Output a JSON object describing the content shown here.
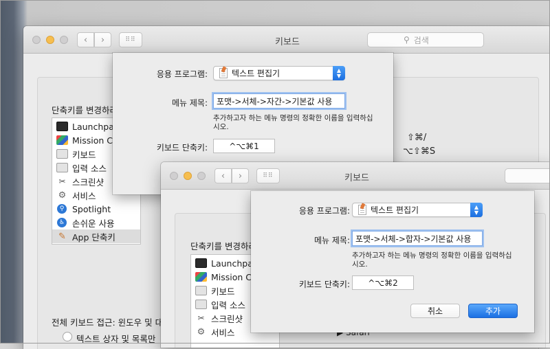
{
  "window_title": "키보드",
  "search_placeholder": "검색",
  "section_label_1": "단축키를 변경하려",
  "section_label_2": "단축키를 변경하려",
  "full_keyboard_label": "전체 키보드 접근: 윈도우 및 대",
  "radio_label": "텍스트 상자 및 목록만",
  "sidebar_items_1": [
    {
      "label": "Launchpa",
      "icon": "launchpad-icon"
    },
    {
      "label": "Mission Co",
      "icon": "mission-control-icon"
    },
    {
      "label": "키보드",
      "icon": "keyboard-icon"
    },
    {
      "label": "입력 소스",
      "icon": "input-source-icon"
    },
    {
      "label": "스크린샷",
      "icon": "screenshot-icon"
    },
    {
      "label": "서비스",
      "icon": "gear-icon"
    },
    {
      "label": "Spotlight",
      "icon": "spotlight-icon"
    },
    {
      "label": "손쉬운 사용",
      "icon": "accessibility-icon"
    },
    {
      "label": "App 단축키",
      "icon": "app-shortcuts-icon"
    }
  ],
  "sidebar_items_2": [
    {
      "label": "Launchpa",
      "icon": "launchpad-icon"
    },
    {
      "label": "Mission Co",
      "icon": "mission-control-icon"
    },
    {
      "label": "키보드",
      "icon": "keyboard-icon"
    },
    {
      "label": "입력 소스",
      "icon": "input-source-icon"
    },
    {
      "label": "스크린샷",
      "icon": "screenshot-icon"
    },
    {
      "label": "서비스",
      "icon": "gear-icon"
    }
  ],
  "shortcut_right_1": "⇧⌘/",
  "shortcut_right_2": "⌥⇧⌘S",
  "tree_item": "Safari",
  "sheet1": {
    "app_label": "응용 프로그램:",
    "app_value": "텍스트 편집기",
    "menu_label": "메뉴 제목:",
    "menu_value": "포맷->서체->자간->기본값 사용",
    "hint": "추가하고자 하는 메뉴 명령의 정확한 이름을 입력하십시오.",
    "hint_line1": "추가하고자 하는 메뉴 명령의 정확한 이름을 입력하십",
    "hint_line2": "시오.",
    "key_label": "키보드 단축키:",
    "key_value": "^⌥⌘1"
  },
  "sheet2": {
    "app_label": "응용 프로그램:",
    "app_value": "텍스트 편집기",
    "menu_label": "메뉴 제목:",
    "menu_value": "포맷->서체->합자->기본값 사용",
    "hint_line1": "추가하고자 하는 메뉴 명령의 정확한 이름을 입력하십",
    "hint_line2": "시오.",
    "key_label": "키보드 단축키:",
    "key_value": "^⌥⌘2",
    "cancel_label": "취소",
    "add_label": "추가"
  },
  "colors": {
    "accent": "#1b6fe3",
    "focus_ring": "#9ec1f0",
    "minimize": "#f6be4f"
  }
}
